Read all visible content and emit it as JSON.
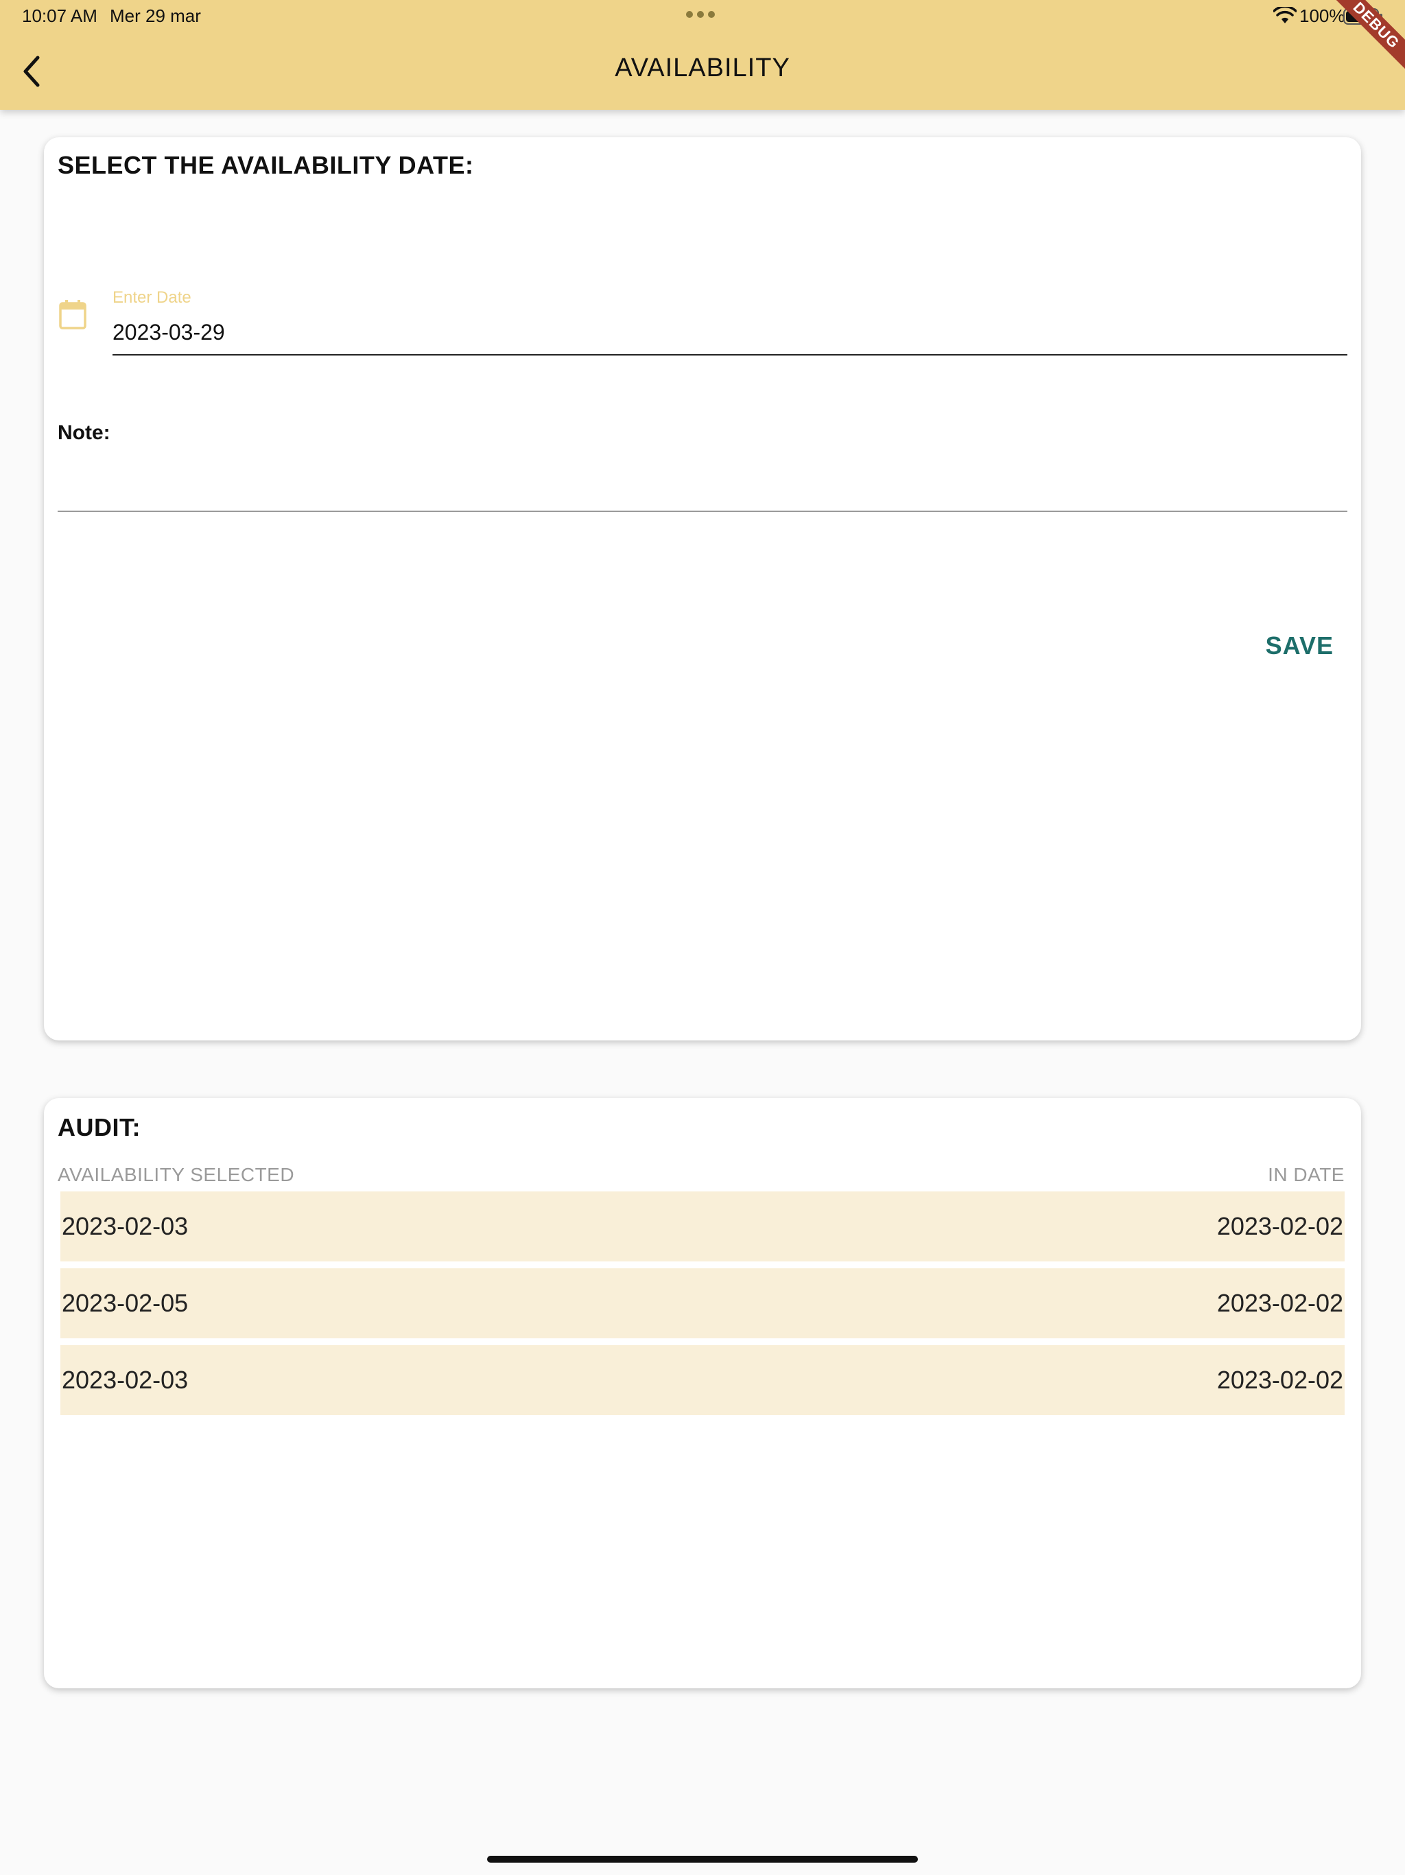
{
  "status_bar": {
    "time": "10:07 AM",
    "date": "Mer 29 mar",
    "battery": "100%"
  },
  "app_bar": {
    "title": "AVAILABILITY",
    "debug_ribbon": "DEBUG",
    "back_icon": "chevron-left-icon"
  },
  "availability_card": {
    "title": "SELECT THE AVAILABILITY DATE:",
    "date_field": {
      "label": "Enter Date",
      "value": "2023-03-29",
      "icon": "calendar-icon"
    },
    "note_label": "Note:",
    "note_value": "",
    "save_label": "SAVE"
  },
  "audit_card": {
    "title": "AUDIT:",
    "columns": [
      "AVAILABILITY SELECTED",
      "IN DATE"
    ],
    "rows": [
      {
        "selected": "2023-02-03",
        "in_date": "2023-02-02"
      },
      {
        "selected": "2023-02-05",
        "in_date": "2023-02-02"
      },
      {
        "selected": "2023-02-03",
        "in_date": "2023-02-02"
      }
    ]
  },
  "colors": {
    "app_bar": "#efd48a",
    "accent_teal": "#1d6e6a",
    "row_background": "#f9efd8",
    "debug_ribbon": "#a33b2b"
  }
}
